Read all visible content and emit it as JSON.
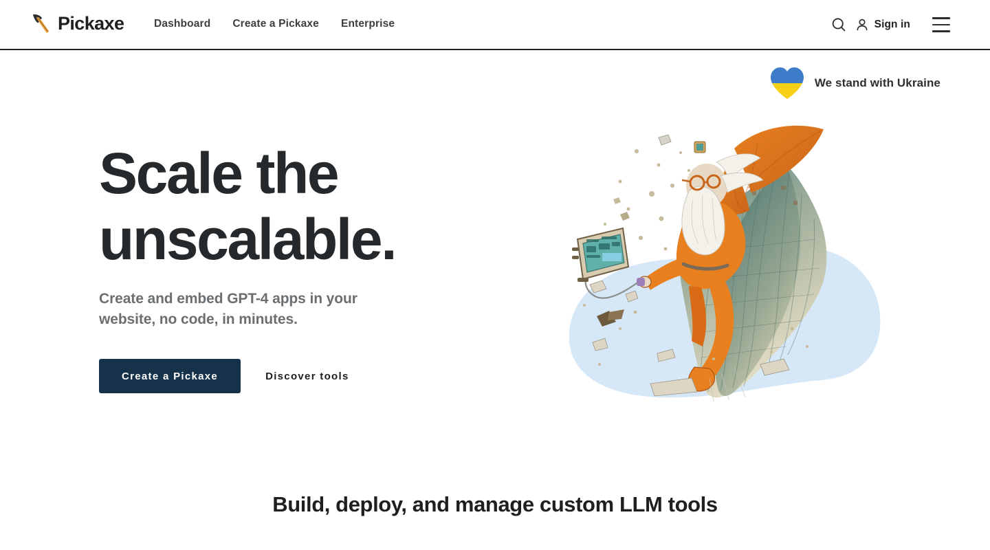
{
  "header": {
    "logo": {
      "icon": "pickaxe-icon",
      "word": "Pickaxe",
      "head_color": "#2b2e30",
      "handle_color": "#f2a33c"
    },
    "nav": [
      {
        "label": "Dashboard"
      },
      {
        "label": "Create a Pickaxe"
      },
      {
        "label": "Enterprise"
      }
    ],
    "search_icon": "search-icon",
    "signin": {
      "icon": "user-icon",
      "label": "Sign in"
    },
    "menu_icon": "hamburger-menu-icon",
    "border_color": "#1d1f21"
  },
  "ukraine_banner": {
    "icon": "ukraine-heart-icon",
    "text": "We stand with Ukraine",
    "heart_top_color": "#3d7cc9",
    "heart_bottom_color": "#f7d117"
  },
  "hero": {
    "title_line_1": "Scale the",
    "title_line_2": "unscalable.",
    "subtitle": "Create and embed GPT-4 apps in your website, no code, in minutes.",
    "primary_cta": "Create a Pickaxe",
    "secondary_cta": "Discover tools",
    "primary_cta_color": "#16324a",
    "illustration": {
      "name": "wizard-riding-falling-cliff-illustration",
      "description": "Bearded wizard with goggles and orange winged robe riding a crumbling basalt cliff, tethered to a vintage CRT monitor, over a light blue blob",
      "blob_color": "#d6e8f8",
      "robe_color": "#e8801f",
      "rock_color": "#5d8a86",
      "screen_color": "#5fb0a8"
    }
  },
  "section": {
    "heading": "Build, deploy, and manage custom LLM tools"
  }
}
